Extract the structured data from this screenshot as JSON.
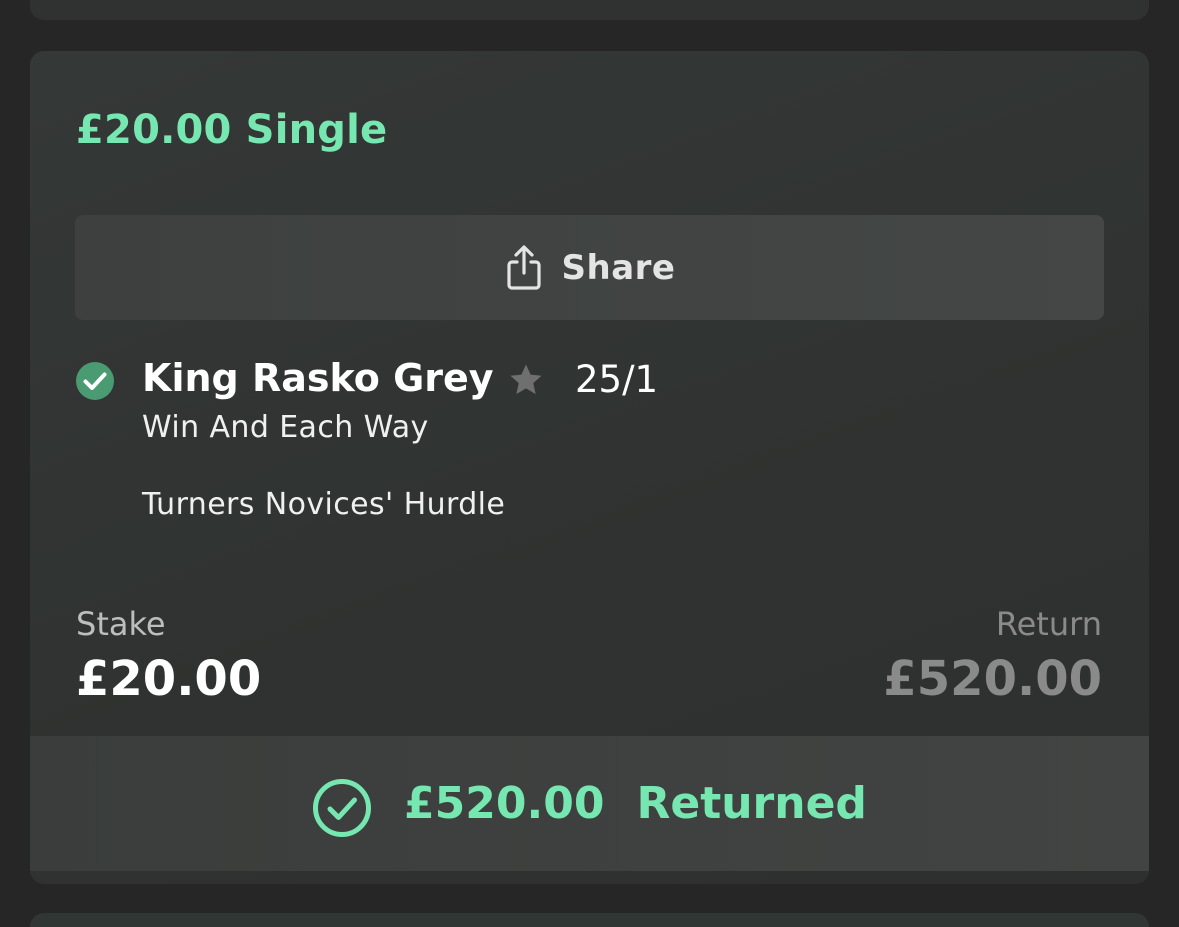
{
  "bet": {
    "title": "£20.00 Single",
    "share_label": "Share",
    "selection": {
      "name": "King Rasko Grey",
      "odds": "25/1",
      "market": "Win And Each Way",
      "event": "Turners Novices' Hurdle",
      "status": "won"
    },
    "stake_label": "Stake",
    "stake_value": "£20.00",
    "return_label": "Return",
    "return_value": "£520.00",
    "returned_amount": "£520.00",
    "returned_label": "Returned"
  },
  "icons": {
    "share": "share-icon",
    "selection_status": "check-circle-filled-icon",
    "favourite": "star-icon",
    "returned": "check-circle-outline-icon"
  },
  "colors": {
    "accent_green": "#76e7b0",
    "check_fill": "#4a9b72",
    "muted_text": "#8a8a8a"
  }
}
